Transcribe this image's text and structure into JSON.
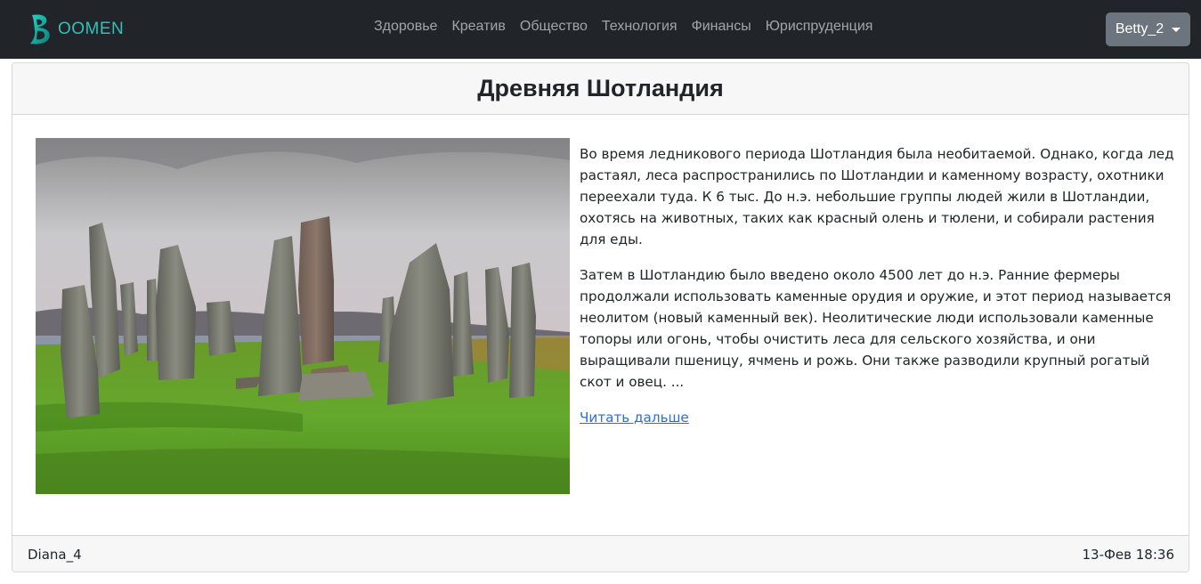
{
  "brand": {
    "text": "OOMEN",
    "logo_icon": "leaf-b-logo-icon",
    "color": "#2fc1b9"
  },
  "nav": {
    "items": [
      {
        "label": "Здоровье"
      },
      {
        "label": "Креатив"
      },
      {
        "label": "Общество"
      },
      {
        "label": "Технология"
      },
      {
        "label": "Финансы"
      },
      {
        "label": "Юриспруденция"
      }
    ]
  },
  "user_menu": {
    "label": "Betty_2",
    "icon": "caret-down-icon"
  },
  "article": {
    "title": "Древняя Шотландия",
    "image_icon": "standing-stones-photo",
    "paragraphs": [
      "Во время ледникового периода Шотландия была необитаемой. Однако, когда лед растаял, леса распространились по Шотландии и каменному возрасту, охотники переехали туда. К 6 тыс. До н.э. небольшие группы людей жили в Шотландии, охотясь на животных, таких как красный олень и тюлени, и собирали растения для еды.",
      "Затем в Шотландию было введено около 4500 лет до н.э. Ранние фермеры продолжали использовать каменные орудия и оружие, и этот период называется неолитом (новый каменный век). Неолитические люди использовали каменные топоры или огонь, чтобы очистить леса для сельского хозяйства, и они выращивали пшеницу, ячмень и рожь. Они также разводили крупный рогатый скот и овец. ..."
    ],
    "read_more": "Читать дальше",
    "author": "Diana_4",
    "date": "13-Фев 18:36"
  },
  "colors": {
    "navbar_bg": "#212529",
    "link": "#2a6fd6",
    "button": "#6c757d"
  }
}
